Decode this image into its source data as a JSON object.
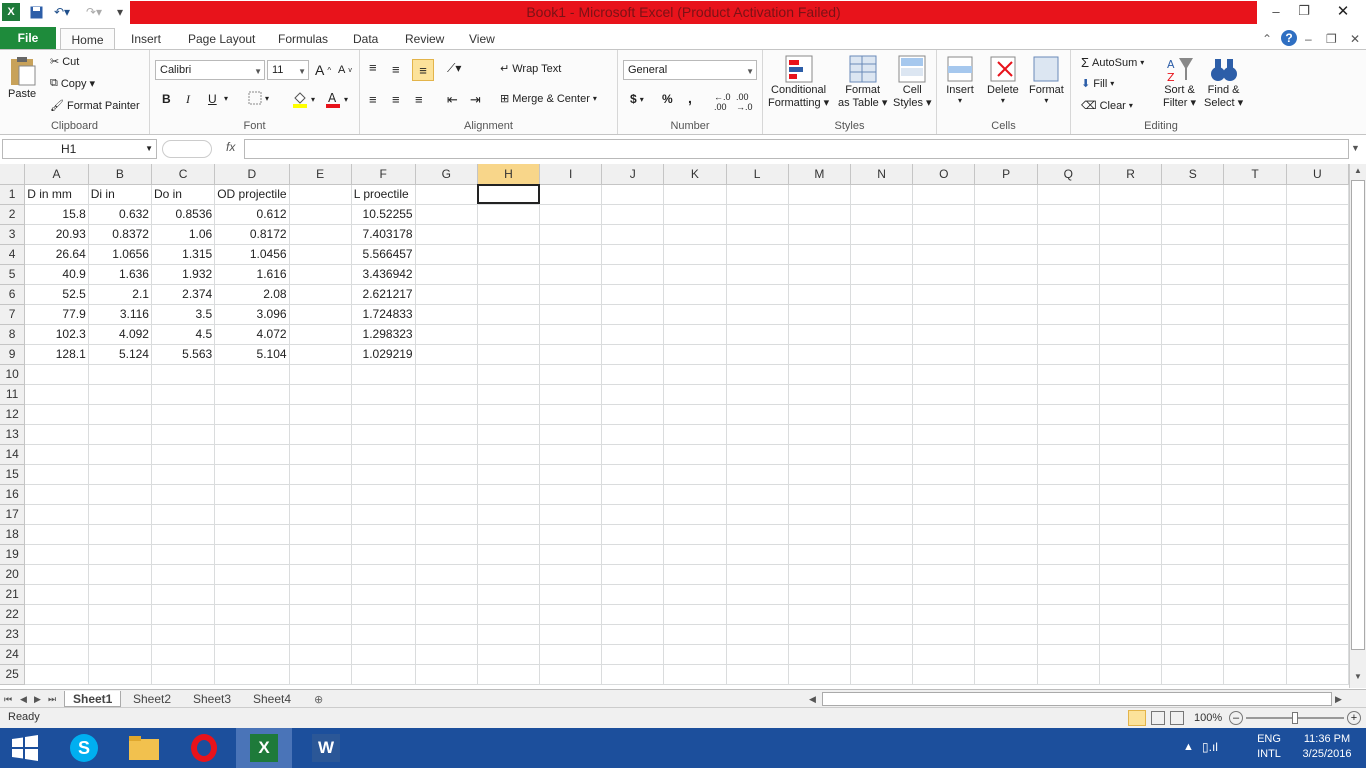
{
  "window": {
    "title": "Book1  -  Microsoft Excel (Product Activation Failed)"
  },
  "tabs": {
    "file": "File",
    "home": "Home",
    "insert": "Insert",
    "page_layout": "Page Layout",
    "formulas": "Formulas",
    "data": "Data",
    "review": "Review",
    "view": "View"
  },
  "clipboard": {
    "paste": "Paste",
    "cut": "Cut",
    "copy": "Copy",
    "format_painter": "Format Painter",
    "label": "Clipboard"
  },
  "font": {
    "name": "Calibri",
    "size": "11",
    "label": "Font",
    "bold": "B",
    "italic": "I",
    "underline": "U"
  },
  "alignment": {
    "wrap_text": "Wrap Text",
    "merge_center": "Merge & Center",
    "label": "Alignment"
  },
  "number": {
    "format": "General",
    "label": "Number",
    "currency": "$",
    "percent": "%",
    "comma": ","
  },
  "styles": {
    "conditional": "Conditional",
    "conditional2": "Formatting",
    "format_table": "Format",
    "format_table2": "as Table",
    "cell_styles": "Cell",
    "cell_styles2": "Styles",
    "label": "Styles"
  },
  "cells": {
    "insert": "Insert",
    "delete": "Delete",
    "format": "Format",
    "label": "Cells"
  },
  "editing": {
    "autosum": "AutoSum",
    "fill": "Fill",
    "clear": "Clear",
    "sort": "Sort &",
    "sort2": "Filter",
    "find": "Find &",
    "find2": "Select",
    "label": "Editing"
  },
  "formula_bar": {
    "name_box": "H1",
    "fx": "fx",
    "content": ""
  },
  "columns": [
    "A",
    "B",
    "C",
    "D",
    "E",
    "F",
    "G",
    "H",
    "I",
    "J",
    "K",
    "L",
    "M",
    "N",
    "O",
    "P",
    "Q",
    "R",
    "S",
    "T",
    "U"
  ],
  "headers": [
    "D in mm",
    "Di in",
    "Do in",
    "OD projectile",
    "",
    "L proectile"
  ],
  "rows": [
    [
      "15.8",
      "0.632",
      "0.8536",
      "0.612",
      "",
      "10.52255"
    ],
    [
      "20.93",
      "0.8372",
      "1.06",
      "0.8172",
      "",
      "7.403178"
    ],
    [
      "26.64",
      "1.0656",
      "1.315",
      "1.0456",
      "",
      "5.566457"
    ],
    [
      "40.9",
      "1.636",
      "1.932",
      "1.616",
      "",
      "3.436942"
    ],
    [
      "52.5",
      "2.1",
      "2.374",
      "2.08",
      "",
      "2.621217"
    ],
    [
      "77.9",
      "3.116",
      "3.5",
      "3.096",
      "",
      "1.724833"
    ],
    [
      "102.3",
      "4.092",
      "4.5",
      "4.072",
      "",
      "1.298323"
    ],
    [
      "128.1",
      "5.124",
      "5.563",
      "5.104",
      "",
      "1.029219"
    ]
  ],
  "row_count": 25,
  "selected_cell": "H1",
  "sheets": [
    "Sheet1",
    "Sheet2",
    "Sheet3",
    "Sheet4"
  ],
  "active_sheet": "Sheet1",
  "status": {
    "ready": "Ready",
    "zoom": "100%"
  },
  "taskbar": {
    "lang1": "ENG",
    "lang2": "INTL",
    "time": "11:36 PM",
    "date": "3/25/2016"
  },
  "colors": {
    "title_bar": "#e8131b",
    "file_tab": "#1e8b3b",
    "taskbar": "#1c4f9c",
    "selected_header": "#f8d68a"
  }
}
